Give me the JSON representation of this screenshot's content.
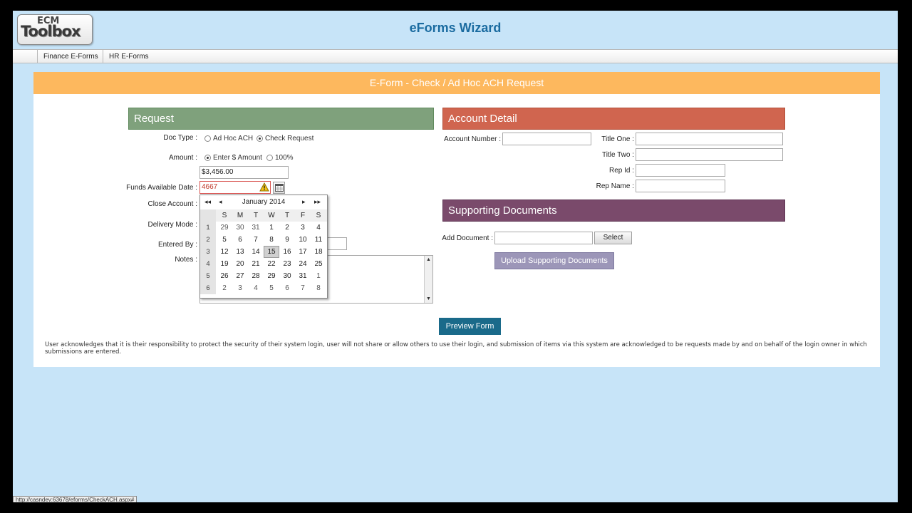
{
  "header": {
    "logo_top": "ECM",
    "logo_main": "Toolbox",
    "app_title": "eForms Wizard"
  },
  "nav": {
    "items": [
      "Finance E-Forms",
      "HR E-Forms"
    ]
  },
  "form": {
    "title": "E-Form - Check / Ad Hoc ACH Request"
  },
  "request": {
    "header": "Request",
    "doc_type_label": "Doc Type :",
    "doc_type_options": [
      "Ad Hoc ACH",
      "Check Request"
    ],
    "amount_label": "Amount :",
    "amount_options": [
      "Enter $ Amount",
      "100%"
    ],
    "amount_value": "$3,456.00",
    "funds_label": "Funds Available Date :",
    "funds_value": "4667",
    "close_account_label": "Close Account :",
    "delivery_mode_label": "Delivery Mode :",
    "entered_by_label": "Entered By :",
    "notes_label": "Notes :"
  },
  "calendar": {
    "title": "January 2014",
    "nav": {
      "prev_year": "◂◂",
      "prev_month": "◂",
      "next_month": "▸",
      "next_year": "▸▸"
    },
    "weekdays": [
      "S",
      "M",
      "T",
      "W",
      "T",
      "F",
      "S"
    ],
    "weeks": [
      {
        "num": "1",
        "days": [
          "29",
          "30",
          "31",
          "1",
          "2",
          "3",
          "4"
        ]
      },
      {
        "num": "2",
        "days": [
          "5",
          "6",
          "7",
          "8",
          "9",
          "10",
          "11"
        ]
      },
      {
        "num": "3",
        "days": [
          "12",
          "13",
          "14",
          "15",
          "16",
          "17",
          "18"
        ]
      },
      {
        "num": "4",
        "days": [
          "19",
          "20",
          "21",
          "22",
          "23",
          "24",
          "25"
        ]
      },
      {
        "num": "5",
        "days": [
          "26",
          "27",
          "28",
          "29",
          "30",
          "31",
          "1"
        ]
      },
      {
        "num": "6",
        "days": [
          "2",
          "3",
          "4",
          "5",
          "6",
          "7",
          "8"
        ]
      }
    ],
    "selected_day": "15"
  },
  "account": {
    "header": "Account Detail",
    "account_number_label": "Account Number :",
    "title_one_label": "Title One :",
    "title_two_label": "Title Two :",
    "rep_id_label": "Rep Id :",
    "rep_name_label": "Rep Name :"
  },
  "supporting": {
    "header": "Supporting Documents",
    "add_document_label": "Add Document :",
    "select_button": "Select",
    "upload_button": "Upload Supporting Documents"
  },
  "preview_button": "Preview Form",
  "disclaimer": "User acknowledges that it is their responsibility to protect the security of their system login, user will not share or allow others to use their login, and submission of items via this system are acknowledged to be requests made by and on behalf of the login owner in which submissions are entered.",
  "status_bar": "http://casndev:63678/eforms/CheckACH.aspx#",
  "colors": {
    "page_bg": "#c7e4f8",
    "title_bar": "#fdb85e",
    "request_header": "#7fa17c",
    "account_header": "#d0654f",
    "supporting_header": "#7a4a6b",
    "preview_button": "#1a6a8a",
    "upload_button": "#9c96b8",
    "app_title": "#1a6ba0"
  },
  "icons": {
    "warning": "warning-icon",
    "calendar": "calendar-icon"
  }
}
